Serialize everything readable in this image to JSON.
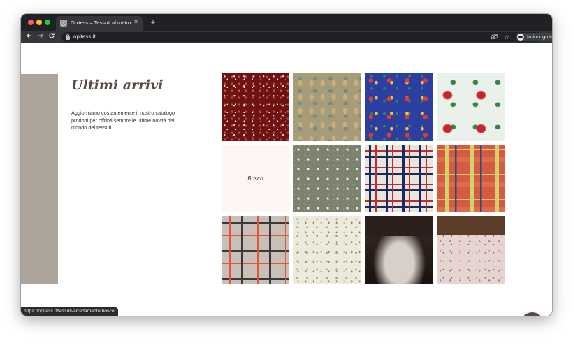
{
  "browser": {
    "tab_title": "Opitess – Tessuti al metro e bia",
    "tab_close": "×",
    "new_tab": "+",
    "url": "opitess.it",
    "incognito_label": "In incognito",
    "back_icon": "arrow-left-icon",
    "forward_icon": "arrow-right-icon",
    "reload_icon": "reload-icon",
    "menu_icon": "kebab-menu-icon"
  },
  "page": {
    "heading": "Ultimi arrivi",
    "intro": "Aggiorniamo costantemente il nostro catalogo prodotti per offrirvi sempre le ultime novità del mondo dei tessuti.",
    "strip_color": "#ada59b",
    "heading_color": "#5a4a44",
    "tiles": [
      {
        "label": "",
        "kind": "red-floral-fabric"
      },
      {
        "label": "",
        "kind": "paisley-olive-fabric"
      },
      {
        "label": "",
        "kind": "paisley-multicolor-fabric"
      },
      {
        "label": "",
        "kind": "poinsettia-fabric"
      },
      {
        "label": "Bosco",
        "kind": "hover-overlay"
      },
      {
        "label": "",
        "kind": "green-heart-pattern-fabric"
      },
      {
        "label": "",
        "kind": "navy-red-tartan-fabric"
      },
      {
        "label": "",
        "kind": "orange-madras-fabric"
      },
      {
        "label": "",
        "kind": "beige-check-fabric"
      },
      {
        "label": "",
        "kind": "leaf-print-fabric"
      },
      {
        "label": "",
        "kind": "bedroom-bedding-photo"
      },
      {
        "label": "",
        "kind": "floral-bedding-photo"
      }
    ]
  },
  "messenger": {
    "icon": "messenger-icon",
    "color": "#5d4a45"
  },
  "status_bar": {
    "text": "https://opitess.it/tessuti-arredamento/bosco/"
  }
}
